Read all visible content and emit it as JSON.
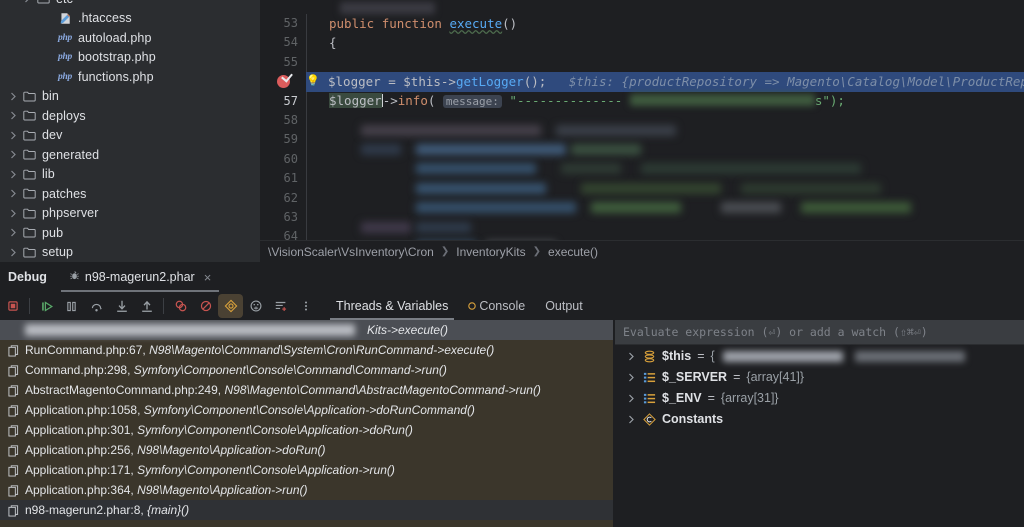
{
  "project_tree": {
    "items": [
      {
        "label": "etc",
        "icon": "folder-icon",
        "depth": 1,
        "expandable": true,
        "partial_top": true
      },
      {
        "label": ".htaccess",
        "icon": "htaccess-icon",
        "depth": 2,
        "expandable": false
      },
      {
        "label": "autoload.php",
        "icon": "php-icon",
        "depth": 2,
        "expandable": false
      },
      {
        "label": "bootstrap.php",
        "icon": "php-icon",
        "depth": 2,
        "expandable": false
      },
      {
        "label": "functions.php",
        "icon": "php-icon",
        "depth": 2,
        "expandable": false
      },
      {
        "label": "bin",
        "icon": "folder-icon",
        "depth": 0,
        "expandable": true
      },
      {
        "label": "deploys",
        "icon": "folder-icon",
        "depth": 0,
        "expandable": true
      },
      {
        "label": "dev",
        "icon": "folder-icon",
        "depth": 0,
        "expandable": true
      },
      {
        "label": "generated",
        "icon": "folder-icon",
        "depth": 0,
        "expandable": true
      },
      {
        "label": "lib",
        "icon": "folder-icon",
        "depth": 0,
        "expandable": true
      },
      {
        "label": "patches",
        "icon": "folder-icon",
        "depth": 0,
        "expandable": true
      },
      {
        "label": "phpserver",
        "icon": "folder-icon",
        "depth": 0,
        "expandable": true
      },
      {
        "label": "pub",
        "icon": "folder-icon",
        "depth": 0,
        "expandable": true
      },
      {
        "label": "setup",
        "icon": "folder-icon",
        "depth": 0,
        "expandable": true
      }
    ]
  },
  "editor": {
    "lines": [
      {
        "num": "",
        "kind": "blurred-partial"
      },
      {
        "num": "53",
        "kind": "code",
        "tokens": [
          {
            "t": "public",
            "c": "kw"
          },
          {
            "t": " ",
            "c": "plain"
          },
          {
            "t": "function",
            "c": "kw"
          },
          {
            "t": " ",
            "c": "plain"
          },
          {
            "t": "execute",
            "c": "fn"
          },
          {
            "t": "()",
            "c": "plain"
          }
        ]
      },
      {
        "num": "54",
        "kind": "code",
        "tokens": [
          {
            "t": "{",
            "c": "plain"
          }
        ]
      },
      {
        "num": "55",
        "kind": "code",
        "tokens": []
      },
      {
        "num": "56",
        "kind": "code-highlight",
        "breakpoint": true,
        "bulb": true,
        "tokens": [
          {
            "t": "$logger",
            "c": "var2"
          },
          {
            "t": " = ",
            "c": "plain"
          },
          {
            "t": "$this",
            "c": "var2"
          },
          {
            "t": "->",
            "c": "plain"
          },
          {
            "t": "getLogger",
            "c": "meth"
          },
          {
            "t": "();",
            "c": "plain"
          }
        ],
        "inline_hint": "$this: {productRepository => Magento\\Catalog\\Model\\ProductRepository\\I"
      },
      {
        "num": "57",
        "kind": "code-caret",
        "tokens": [
          {
            "t": "$logger",
            "c": "var2 sel-word"
          },
          {
            "t": "->",
            "c": "plain"
          },
          {
            "t": "info",
            "c": "kw"
          },
          {
            "t": "(",
            "c": "plain"
          }
        ],
        "inlay": "message:",
        "string_prefix": "\"-------------- ",
        "string_suffix": "s\");"
      },
      {
        "num": "58",
        "kind": "blurred"
      },
      {
        "num": "59",
        "kind": "blurred"
      },
      {
        "num": "60",
        "kind": "blurred"
      },
      {
        "num": "61",
        "kind": "blurred"
      },
      {
        "num": "62",
        "kind": "blurred"
      },
      {
        "num": "63",
        "kind": "blurred"
      },
      {
        "num": "64",
        "kind": "blurred"
      }
    ],
    "breadcrumb": [
      "\\VisionScaler\\VsInventory\\Cron",
      "InventoryKits",
      "execute()"
    ]
  },
  "debug": {
    "panel_title": "Debug",
    "session_tab": {
      "label": "n98-magerun2.phar",
      "icon": "bug-icon",
      "close": "×"
    },
    "toolbar": [
      {
        "name": "stop-button",
        "icon": "stop-icon",
        "color": "#c75450"
      },
      {
        "name": "resume-button",
        "icon": "resume-icon",
        "color": "#59a869"
      },
      {
        "name": "pause-button",
        "icon": "pause-icon",
        "color": "#9aa0a6"
      },
      {
        "name": "step-over-button",
        "icon": "step-over-icon",
        "color": "#9aa0a6"
      },
      {
        "name": "step-into-button",
        "icon": "step-into-icon",
        "color": "#9aa0a6"
      },
      {
        "name": "step-out-button",
        "icon": "step-out-icon",
        "color": "#9aa0a6"
      },
      {
        "name": "view-breakpoints-button",
        "icon": "breakpoints-icon",
        "color": "#c75450"
      },
      {
        "name": "mute-breakpoints-button",
        "icon": "mute-breakpoints-icon",
        "color": "#c75450"
      },
      {
        "name": "settings-target-button",
        "icon": "target-icon",
        "color": "#d9a13b",
        "active": true
      },
      {
        "name": "evaluate-expression-button",
        "icon": "evaluate-icon",
        "color": "#9aa0a6"
      },
      {
        "name": "add-to-watches-button",
        "icon": "add-watch-icon",
        "color": "#9aa0a6"
      },
      {
        "name": "more-options-button",
        "icon": "kebab-menu-icon",
        "color": "#9aa0a6"
      }
    ],
    "tabs": [
      {
        "label": "Threads & Variables",
        "selected": true
      },
      {
        "label": "Console",
        "selected": false,
        "icon": "console-warning-icon"
      },
      {
        "label": "Output",
        "selected": false
      }
    ],
    "frames": [
      {
        "text": "",
        "suffix": "Kits->execute()",
        "selected": true,
        "blurred": true
      },
      {
        "file": "RunCommand.php:67,",
        "ns": "N98\\Magento\\Command\\System\\Cron\\RunCommand->execute()"
      },
      {
        "file": "Command.php:298,",
        "ns": "Symfony\\Component\\Console\\Command\\Command->run()"
      },
      {
        "file": "AbstractMagentoCommand.php:249,",
        "ns": "N98\\Magento\\Command\\AbstractMagentoCommand->run()"
      },
      {
        "file": "Application.php:1058,",
        "ns": "Symfony\\Component\\Console\\Application->doRunCommand()"
      },
      {
        "file": "Application.php:301,",
        "ns": "Symfony\\Component\\Console\\Application->doRun()"
      },
      {
        "file": "Application.php:256,",
        "ns": "N98\\Magento\\Application->doRun()"
      },
      {
        "file": "Application.php:171,",
        "ns": "Symfony\\Component\\Console\\Application->run()"
      },
      {
        "file": "Application.php:364,",
        "ns": "N98\\Magento\\Application->run()"
      },
      {
        "file": "n98-magerun2.phar:8,",
        "ns": "{main}()",
        "highlighted": true
      }
    ],
    "evaluate_placeholder": "Evaluate expression (⏎) or add a watch (⇧⌘⏎)",
    "variables": [
      {
        "name": "$this",
        "eq": " = ",
        "value": "{",
        "icon": "object-icon",
        "blurred_value": true
      },
      {
        "name": "$_SERVER",
        "eq": " = ",
        "value": "{array[41]}",
        "icon": "array-icon"
      },
      {
        "name": "$_ENV",
        "eq": " = ",
        "value": "{array[31]}",
        "icon": "array-icon"
      },
      {
        "name": "Constants",
        "eq": "",
        "value": "",
        "icon": "constants-icon"
      }
    ]
  },
  "colors": {
    "background": "#1e1f22",
    "tree_bg": "#2b2d30",
    "frames_bg": "#3b362b",
    "highlight_line": "#2f4a7d",
    "accent_yellow": "#d9a13b",
    "accent_green": "#59a869",
    "accent_red": "#c75450"
  }
}
